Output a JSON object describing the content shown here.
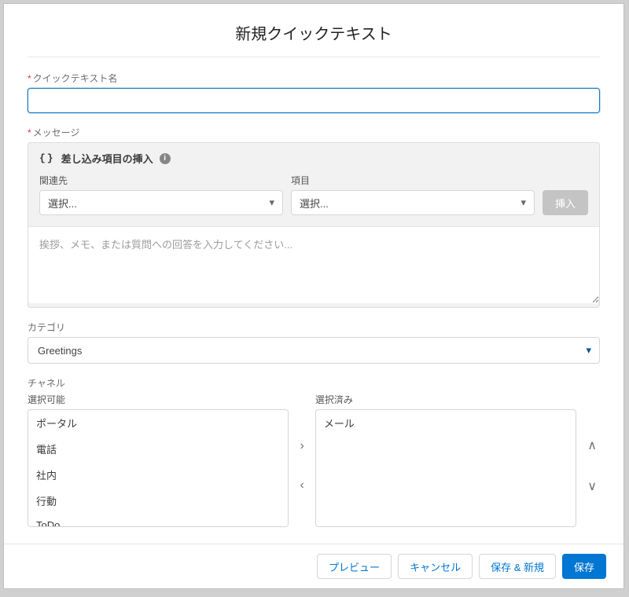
{
  "header": {
    "title": "新規クイックテキスト"
  },
  "fields": {
    "name_label": "クイックテキスト名",
    "message_label": "メッセージ",
    "merge_title": "差し込み項目の挿入",
    "related_label": "関連先",
    "related_placeholder": "選択...",
    "item_label": "項目",
    "item_placeholder": "選択...",
    "insert_btn": "挿入",
    "message_placeholder": "挨拶、メモ、または質問への回答を入力してください...",
    "category_label": "カテゴリ",
    "category_value": "Greetings",
    "channel_label": "チャネル",
    "available_label": "選択可能",
    "selected_label": "選択済み"
  },
  "channels_available": [
    "ポータル",
    "電話",
    "社内",
    "行動",
    "ToDo"
  ],
  "channels_selected": [
    "メール"
  ],
  "footer": {
    "preview": "プレビュー",
    "cancel": "キャンセル",
    "save_new": "保存 & 新規",
    "save": "保存"
  }
}
